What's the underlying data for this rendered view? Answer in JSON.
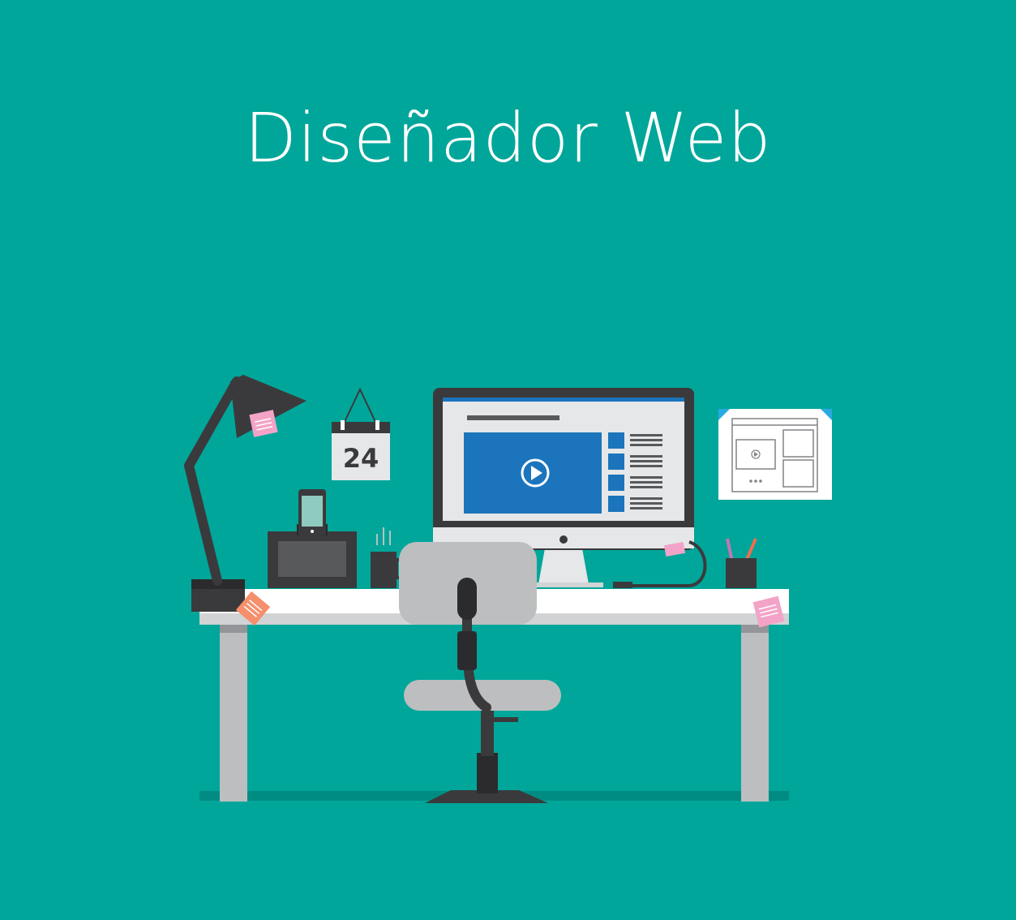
{
  "title": "Diseñador Web",
  "calendar": {
    "day": "24"
  },
  "colors": {
    "background": "#00A69A",
    "desk": "#FFFFFF",
    "desk_edge": "#C7C8CA",
    "dark": "#3A3A3C",
    "screen_blue": "#1C75BC",
    "sticky_pink": "#F3A3C8",
    "sticky_orange": "#F58F6C",
    "chair": "#BCBEC0",
    "floor_shadow": "#008C82"
  },
  "icons": [
    "desk-lamp-icon",
    "calendar-icon",
    "phone-dock-icon",
    "mug-icon",
    "monitor-icon",
    "play-icon",
    "wireframe-poster-icon",
    "pencil-cup-icon",
    "office-chair-icon",
    "sticky-note-icon"
  ]
}
